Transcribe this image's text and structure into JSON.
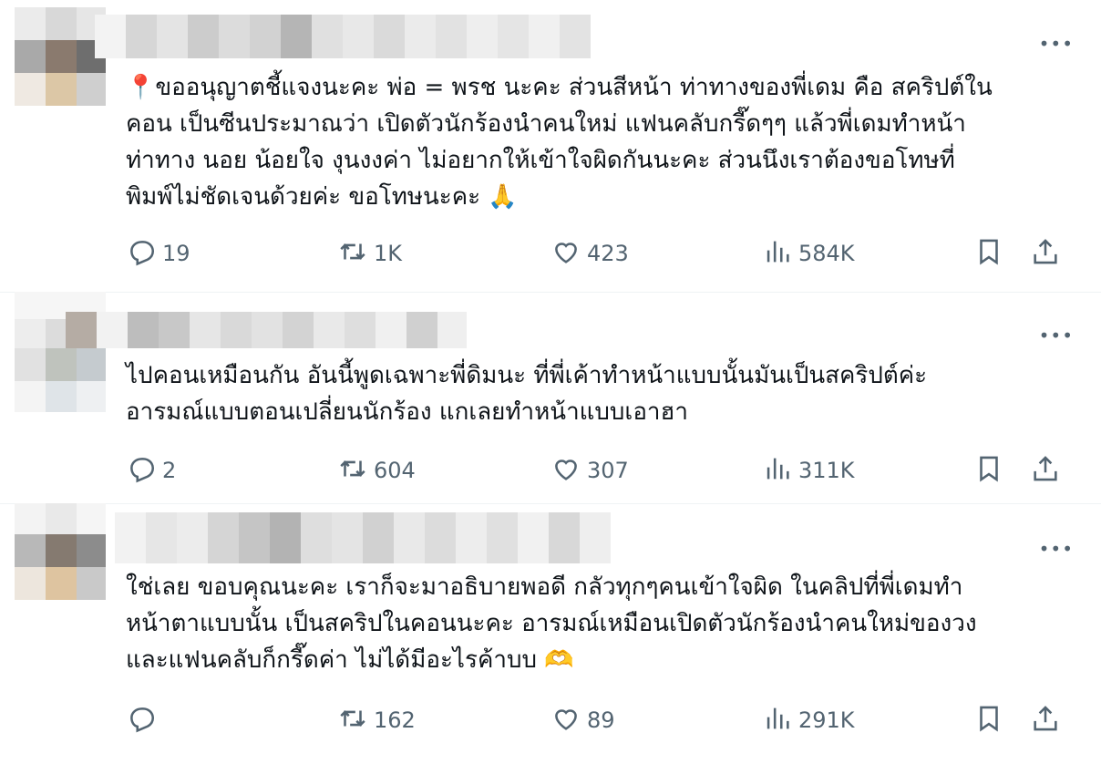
{
  "colors": {
    "text": "#0f1419",
    "muted": "#536471",
    "divider": "#eff3f4"
  },
  "tweets": [
    {
      "text": "📍ขออนุญาตชี้แจงนะคะ พ่อ = พรช นะคะ ส่วนสีหน้า ท่าทางของพี่เดม คือ สคริปต์ใน\nคอน เป็นซีนประมาณว่า เปิดตัวนักร้องนำคนใหม่ แฟนคลับกรี๊ดๆๆ แล้วพี่เดมทำหน้า\nท่าทาง นอย น้อยใจ งุนงงค่า ไม่อยากให้เข้าใจผิดกันนะคะ ส่วนนึงเราต้องขอโทษที่\nพิมพ์ไม่ชัดเจนด้วยค่ะ ขอโทษนะคะ 🙏",
      "replies": "19",
      "reposts": "1K",
      "likes": "423",
      "views": "584K"
    },
    {
      "text": "ไปคอนเหมือนกัน อันนี้พูดเฉพาะพี่ดิมนะ ที่พี่เค้าทำหน้าแบบนั้นมันเป็นสคริปต์ค่ะ\nอารมณ์แบบตอนเปลี่ยนนักร้อง แกเลยทำหน้าแบบเอาฮา",
      "replies": "2",
      "reposts": "604",
      "likes": "307",
      "views": "311K"
    },
    {
      "text": "ใช่เลย ขอบคุณนะคะ เราก็จะมาอธิบายพอดี กลัวทุกๆคนเข้าใจผิด ในคลิปที่พี่เดมทำ\nหน้าตาแบบนั้น เป็นสคริปในคอนนะคะ อารมณ์เหมือนเปิดตัวนักร้องนำคนใหม่ของวง\nและแฟนคลับก็กรี๊ดค่า ไม่ได้มีอะไรค้าบบ 🫶",
      "replies": "",
      "reposts": "162",
      "likes": "89",
      "views": "291K"
    }
  ],
  "icons": {
    "reply": "reply-icon",
    "repost": "repost-icon",
    "like": "heart-icon",
    "views": "views-icon",
    "bookmark": "bookmark-icon",
    "share": "share-icon",
    "more": "more-icon"
  },
  "more_label": "•••"
}
